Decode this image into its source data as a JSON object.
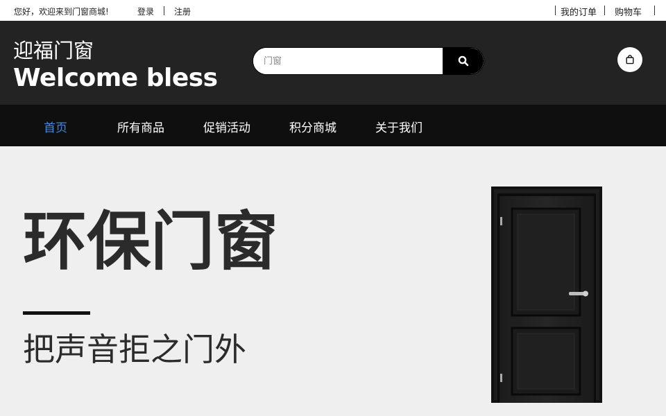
{
  "topbar": {
    "welcome": "您好，欢迎来到门窗商城!",
    "login": "登录",
    "register": "注册",
    "orders": "我的订单",
    "cart": "购物车"
  },
  "header": {
    "logo_cn": "迎福门窗",
    "logo_en": "Welcome bless",
    "search_placeholder": "门窗",
    "search_icon": "search-icon",
    "bag_icon": "shopping-bag-icon"
  },
  "nav": {
    "items": [
      {
        "label": "首页",
        "active": true
      },
      {
        "label": "所有商品",
        "active": false
      },
      {
        "label": "促销活动",
        "active": false
      },
      {
        "label": "积分商城",
        "active": false
      },
      {
        "label": "关于我们",
        "active": false
      }
    ]
  },
  "hero": {
    "title": "环保门窗",
    "subtitle": "把声音拒之门外",
    "image": "black-door"
  },
  "colors": {
    "header_bg": "#232323",
    "nav_bg": "#0f0f0f",
    "nav_active": "#3d8ae8",
    "hero_bg": "#efefef"
  }
}
